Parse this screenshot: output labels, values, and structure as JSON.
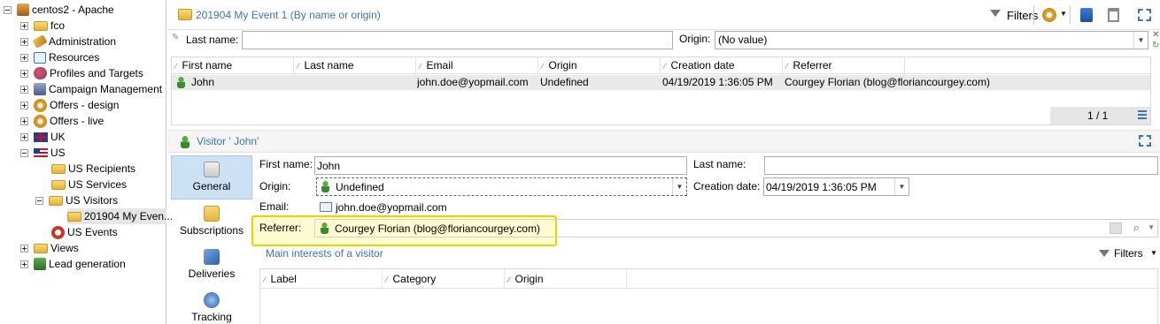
{
  "tree": {
    "root": "centos2 - Apache",
    "items": [
      {
        "label": "fco"
      },
      {
        "label": "Administration"
      },
      {
        "label": "Resources"
      },
      {
        "label": "Profiles and Targets"
      },
      {
        "label": "Campaign Management"
      },
      {
        "label": "Offers - design"
      },
      {
        "label": "Offers - live"
      },
      {
        "label": "UK"
      },
      {
        "label": "US"
      },
      {
        "label": "US Recipients"
      },
      {
        "label": "US Services"
      },
      {
        "label": "US Visitors"
      },
      {
        "label": "201904 My Even..."
      },
      {
        "label": "US Events"
      },
      {
        "label": "Views"
      },
      {
        "label": "Lead generation"
      }
    ]
  },
  "list": {
    "title": "201904 My Event 1 (By name or origin)",
    "filters_label": "Filters",
    "lastname_label": "Last name:",
    "lastname_value": "",
    "origin_label": "Origin:",
    "origin_value": "(No value)",
    "columns": [
      "First name",
      "Last name",
      "Email",
      "Origin",
      "Creation date",
      "Referrer"
    ],
    "rows": [
      {
        "first": "John",
        "last": "",
        "email": "john.doe@yopmail.com",
        "origin": "Undefined",
        "created": "04/19/2019 1:36:05 PM",
        "referrer": "Courgey Florian (blog@floriancourgey.com)"
      }
    ],
    "pager": "1 / 1"
  },
  "detail": {
    "title": "Visitor ' John'",
    "tabs": [
      {
        "label": "General"
      },
      {
        "label": "Subscriptions"
      },
      {
        "label": "Deliveries"
      },
      {
        "label": "Tracking"
      }
    ],
    "form": {
      "first_name_label": "First name:",
      "first_name_value": "John",
      "last_name_label": "Last name:",
      "last_name_value": "",
      "origin_label": "Origin:",
      "origin_value": "Undefined",
      "creation_label": "Creation date:",
      "creation_value": "04/19/2019 1:36:05 PM",
      "email_label": "Email:",
      "email_value": "john.doe@yopmail.com",
      "referrer_label": "Referrer:",
      "referrer_value": "Courgey Florian (blog@floriancourgey.com)"
    },
    "interests_link": "Main interests of a visitor",
    "interests_filters": "Filters",
    "interest_columns": [
      "Label",
      "Category",
      "Origin"
    ]
  },
  "colors": {
    "highlight_border": "#e8d200",
    "highlight_bg": "#fffbd0",
    "link": "#3d74b5",
    "header_bg": "#f5f5f5",
    "selected_tab": "#cde1f5"
  }
}
